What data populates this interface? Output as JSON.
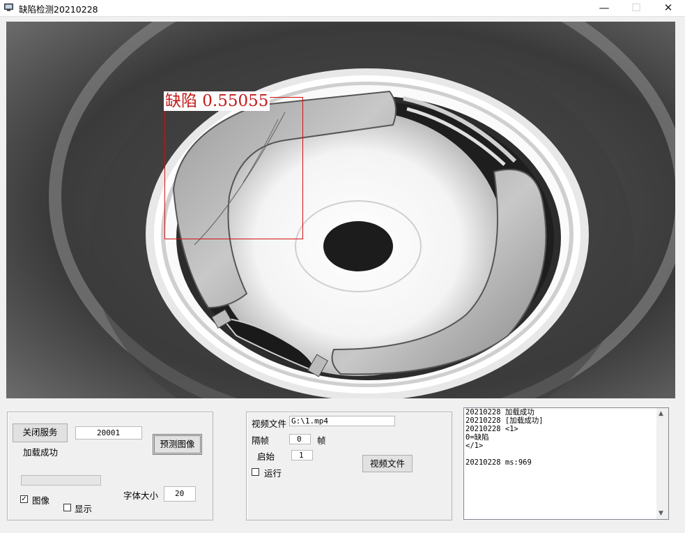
{
  "window": {
    "title": "缺陷检测20210228",
    "minimize_glyph": "—",
    "maximize_glyph": "☐",
    "close_glyph": "✕",
    "icon": "app-icon"
  },
  "detection": {
    "label": "缺陷 0.55055",
    "box_color": "#d01010"
  },
  "left_panel": {
    "close_service_button": "关闭服务",
    "port_value": "20001",
    "status_text": "加载成功",
    "predict_button": "预测图像",
    "image_checkbox_label": "图像",
    "image_checked": true,
    "show_checkbox_label": "显示",
    "show_checked": false,
    "font_size_label": "字体大小",
    "font_size_value": "20"
  },
  "middle_panel": {
    "video_file_label": "视频文件",
    "video_file_value": "G:\\1.mp4",
    "interval_label": "隔帧",
    "interval_value": "0",
    "frame_unit": "帧",
    "start_label": "启始",
    "start_value": "1",
    "run_checkbox_label": "运行",
    "run_checked": false,
    "video_file_button": "视频文件"
  },
  "log": {
    "lines": [
      "20210228 加载成功",
      "20210228 [加载成功]",
      "20210228 <1>",
      "0=缺陷",
      "</1>",
      "",
      "20210228 ms:969"
    ]
  }
}
